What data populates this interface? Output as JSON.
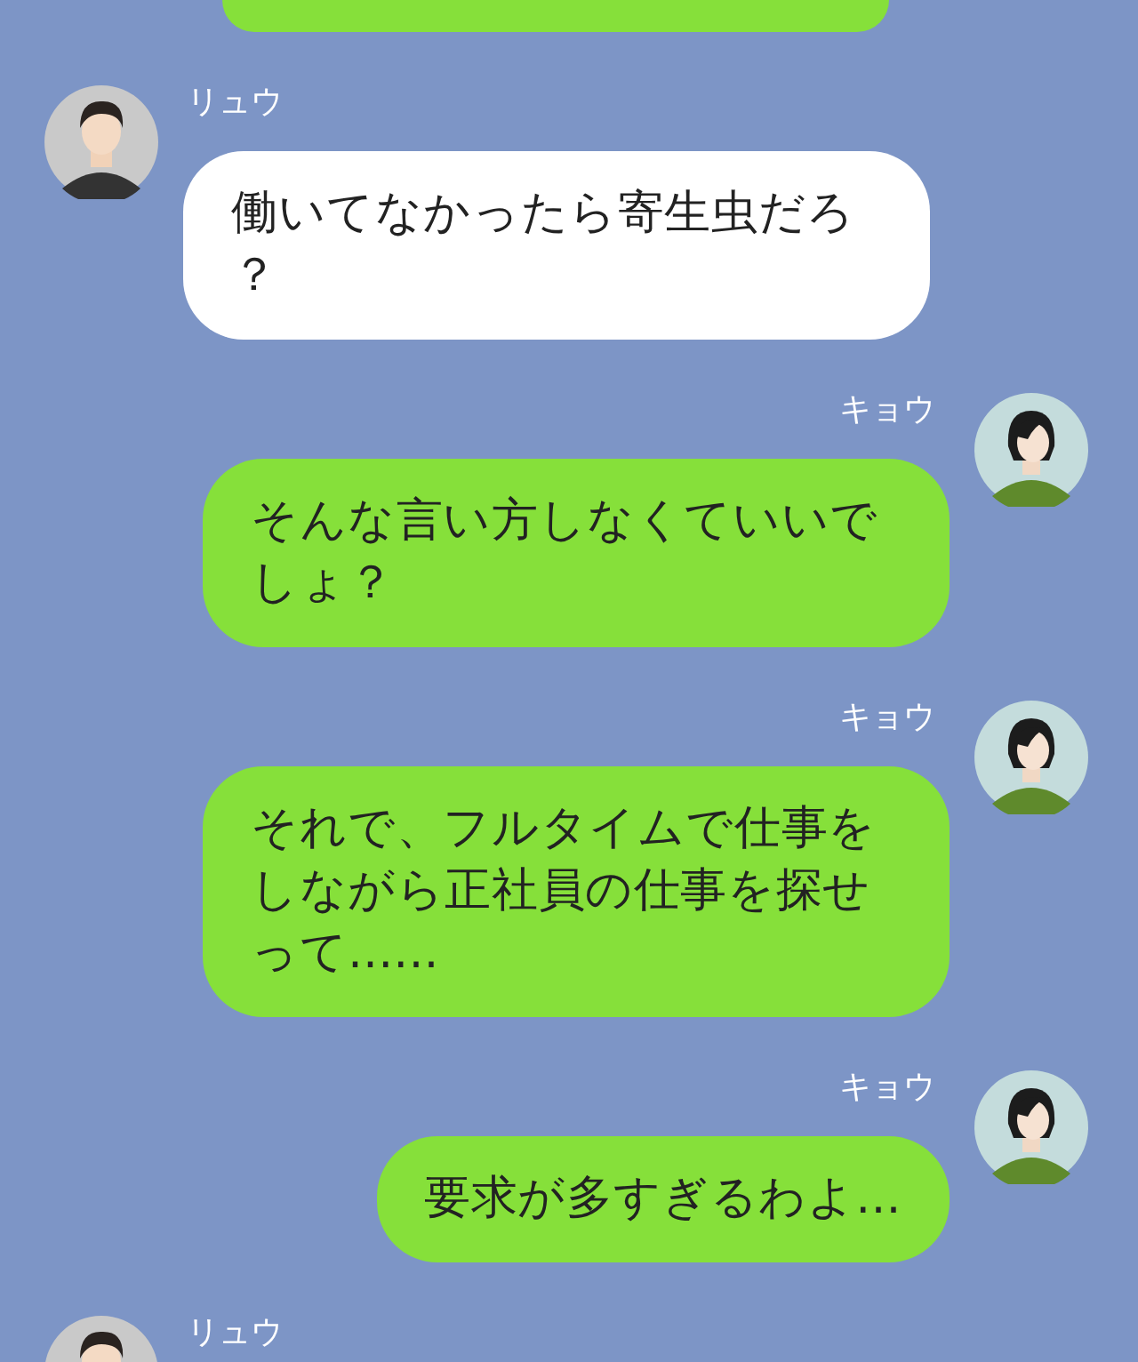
{
  "top_cut_bubble": {
    "kind": "sent"
  },
  "messages": [
    {
      "sender": "リュウ",
      "kind": "received",
      "text": "働いてなかったら寄生虫だろ？"
    },
    {
      "sender": "キョウ",
      "kind": "sent",
      "text": "そんな言い方しなくていいでしょ？"
    },
    {
      "sender": "キョウ",
      "kind": "sent",
      "text": "それで、フルタイムで仕事をしながら正社員の仕事を探せって......"
    },
    {
      "sender": "キョウ",
      "kind": "sent",
      "text": "要求が多すぎるわよ..."
    },
    {
      "sender": "リュウ",
      "kind": "received"
    }
  ]
}
